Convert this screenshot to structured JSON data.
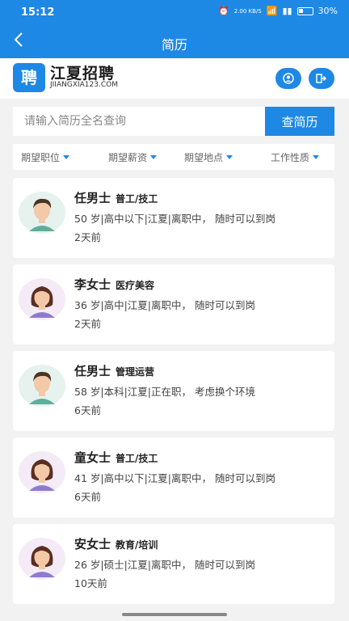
{
  "status": {
    "time": "15:12",
    "speed": "2.00 KB/S",
    "battery": "30%"
  },
  "nav": {
    "back_icon": "chevron-left-icon",
    "title": "简历"
  },
  "brand": {
    "logo_glyph": "聘",
    "name": "江夏招聘",
    "domain": "JIIANGXIA123.COM"
  },
  "header_buttons": [
    {
      "icon": "user-icon"
    },
    {
      "icon": "logout-icon"
    }
  ],
  "search": {
    "placeholder": "请输入简历全名查询",
    "button_label": "查简历"
  },
  "filters": [
    "期望职位",
    "期望薪资",
    "期望地点",
    "工作性质"
  ],
  "resumes": [
    {
      "name": "任男士",
      "job": "普工/技工",
      "info": "50 岁|高中以下|江夏|离职中，  随时可以到岗",
      "ago": "2天前",
      "gender": "male"
    },
    {
      "name": "李女士",
      "job": "医疗美容",
      "info": "36 岁|高中|江夏|离职中，  随时可以到岗",
      "ago": "2天前",
      "gender": "female"
    },
    {
      "name": "任男士",
      "job": "管理运营",
      "info": "58 岁|本科|江夏|正在职，  考虑换个环境",
      "ago": "6天前",
      "gender": "male"
    },
    {
      "name": "童女士",
      "job": "普工/技工",
      "info": "41 岁|高中以下|江夏|离职中，  随时可以到岗",
      "ago": "6天前",
      "gender": "female"
    },
    {
      "name": "安女士",
      "job": "教育/培训",
      "info": "26 岁|硕士|江夏|离职中，  随时可以到岗",
      "ago": "10天前",
      "gender": "female"
    }
  ],
  "colors": {
    "primary": "#1e88e5",
    "background": "#f2f2f2"
  }
}
